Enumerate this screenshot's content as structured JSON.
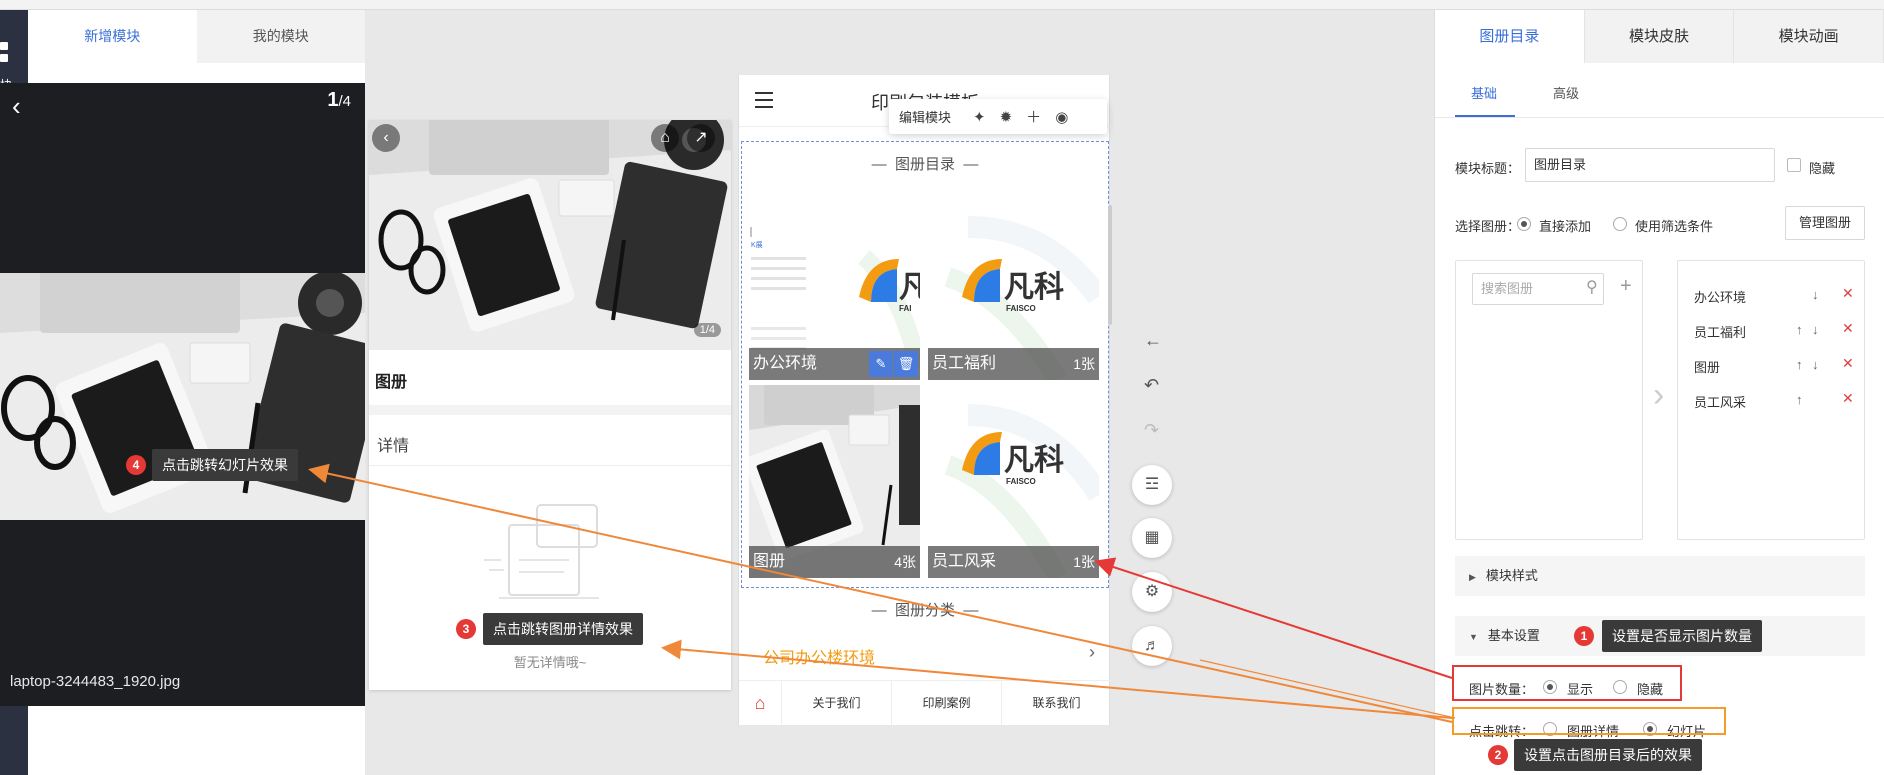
{
  "left_panel": {
    "tabs": [
      "新增模块",
      "我的模块"
    ],
    "rail_label": "块"
  },
  "slideshow": {
    "page_current": "1",
    "page_total": "/4",
    "filename": "laptop-3244483_1920.jpg"
  },
  "detail": {
    "title": "图册",
    "subtitle": "详情",
    "empty_text": "暂无详情哦~",
    "count": "1/4"
  },
  "phone": {
    "title": "印刷包装模板",
    "edit_bar_label": "编辑模块",
    "section1_title": "图册目录",
    "cells": [
      {
        "name": "办公环境",
        "count": ""
      },
      {
        "name": "员工福利",
        "count": "1张"
      },
      {
        "name": "图册",
        "count": "4张"
      },
      {
        "name": "员工风采",
        "count": "1张"
      }
    ],
    "section2_title": "图册分类",
    "category_link": "公司办公楼环境",
    "brand_cn": "凡科",
    "brand_en": "FAISCO",
    "nav": [
      "关于我们",
      "印刷案例",
      "联系我们"
    ]
  },
  "right_panel": {
    "tabs": [
      "图册目录",
      "模块皮肤",
      "模块动画"
    ],
    "subtabs": [
      "基础",
      "高级"
    ],
    "module_title_label": "模块标题：",
    "module_title_value": "图册目录",
    "hide_label": "隐藏",
    "select_album_label": "选择图册：",
    "opt_direct": "直接添加",
    "opt_filter": "使用筛选条件",
    "manage_button": "管理图册",
    "search_placeholder": "搜索图册",
    "selected_albums": [
      "办公环境",
      "员工福利",
      "图册",
      "员工风采"
    ],
    "style_section": "模块样式",
    "basic_section": "基本设置",
    "photo_count_label": "图片数量：",
    "show": "显示",
    "hide": "隐藏",
    "click_jump_label": "点击跳转：",
    "opt_detail": "图册详情",
    "opt_slide": "幻灯片"
  },
  "callouts": {
    "c1": "设置是否显示图片数量",
    "c2": "设置点击图册目录后的效果",
    "c3": "点击跳转图册详情效果",
    "c4": "点击跳转幻灯片效果"
  },
  "badges": [
    "1",
    "2",
    "3",
    "4"
  ],
  "colors": {
    "accent": "#3a6fd8",
    "red": "#e53935",
    "orange": "#f39c2a",
    "link": "#f39c12"
  }
}
